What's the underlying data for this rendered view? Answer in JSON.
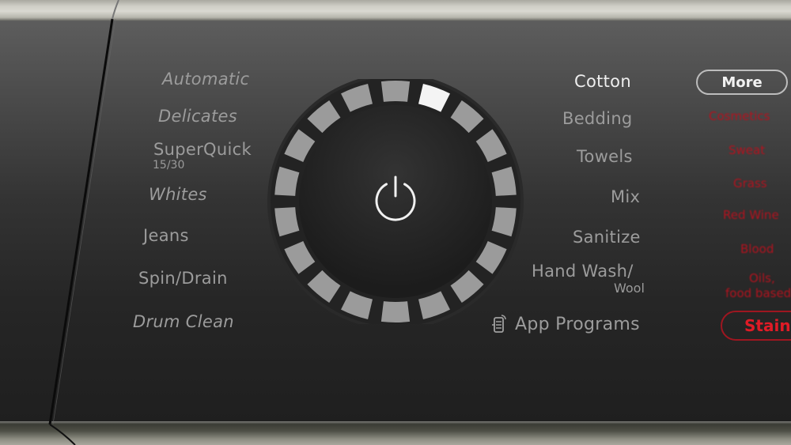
{
  "left_programs": [
    {
      "label": "Automatic",
      "style": "italic"
    },
    {
      "label": "Delicates",
      "style": "italic"
    },
    {
      "label": "SuperQuick",
      "sub": "15/30",
      "style": "normal"
    },
    {
      "label": "Whites",
      "style": "italic"
    },
    {
      "label": "Jeans",
      "style": "normal"
    },
    {
      "label": "Spin/Drain",
      "style": "normal"
    },
    {
      "label": "Drum Clean",
      "style": "italic"
    }
  ],
  "right_programs": [
    {
      "label": "Cotton",
      "selected": true
    },
    {
      "label": "Bedding",
      "selected": false
    },
    {
      "label": "Towels",
      "selected": false
    },
    {
      "label": "Mix",
      "selected": false
    },
    {
      "label": "Sanitize",
      "selected": false
    },
    {
      "label": "Hand Wash/",
      "sub": "Wool",
      "selected": false
    },
    {
      "label": "App Programs",
      "icon": "smartphone-remote-icon",
      "selected": false
    }
  ],
  "more_button": {
    "label": "More"
  },
  "stain_options": [
    {
      "label": "Cosmetics"
    },
    {
      "label": "Sweat"
    },
    {
      "label": "Grass"
    },
    {
      "label": "Red Wine"
    },
    {
      "label": "Blood"
    },
    {
      "label": "Oils,",
      "sub": "food based"
    }
  ],
  "stain_button": {
    "label": "Stain"
  },
  "dial": {
    "segment_count": 18,
    "active_segment_index": 1,
    "center_icon": "power-icon"
  },
  "colors": {
    "accent_red": "#e01b26",
    "stain_text_red": "#b3121e",
    "segment_on": "#f4f4f4",
    "segment_off": "#9b9b9b",
    "label_text": "#9c9c9c",
    "selected_text": "#eeeeee"
  }
}
